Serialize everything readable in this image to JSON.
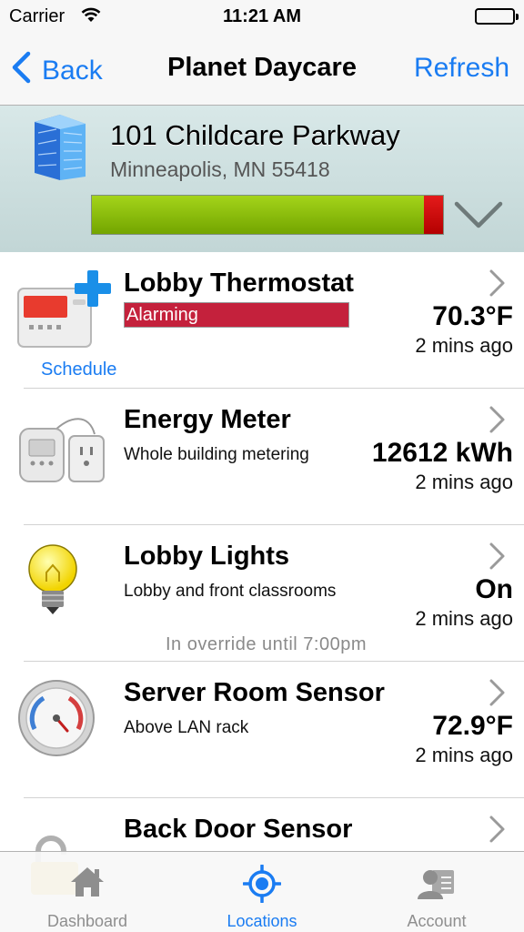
{
  "status_bar": {
    "carrier": "Carrier",
    "time": "11:21 AM"
  },
  "nav": {
    "back_label": "Back",
    "title": "Planet Daycare",
    "refresh_label": "Refresh"
  },
  "location": {
    "address": "101 Childcare Parkway",
    "city_state_zip": "Minneapolis, MN 55418",
    "health_ok_fraction": 0.945,
    "icon": "building-icon"
  },
  "devices": [
    {
      "name": "Lobby Thermostat",
      "status_badge": "Alarming",
      "value": "70.3°F",
      "updated": "2 mins ago",
      "link": "Schedule",
      "icon": "thermostat-icon"
    },
    {
      "name": "Energy Meter",
      "description": "Whole building metering",
      "value": "12612 kWh",
      "updated": "2 mins ago",
      "icon": "energy-meter-icon"
    },
    {
      "name": "Lobby Lights",
      "description": "Lobby and front classrooms",
      "value": "On",
      "updated": "2 mins ago",
      "note": "In override until  7:00pm",
      "icon": "light-bulb-icon"
    },
    {
      "name": "Server Room Sensor",
      "description": "Above LAN rack",
      "value": "72.9°F",
      "updated": "2 mins ago",
      "icon": "gauge-icon"
    },
    {
      "name": "Back Door Sensor",
      "icon": "padlock-icon"
    }
  ],
  "tabs": [
    {
      "label": "Dashboard",
      "icon": "house-icon",
      "active": false
    },
    {
      "label": "Locations",
      "icon": "location-target-icon",
      "active": true
    },
    {
      "label": "Account",
      "icon": "account-icon",
      "active": false
    }
  ],
  "colors": {
    "accent": "#1a7cf2",
    "alarm": "#c4213c",
    "health_ok": "#8cc20a",
    "health_bad": "#d40f0f"
  }
}
